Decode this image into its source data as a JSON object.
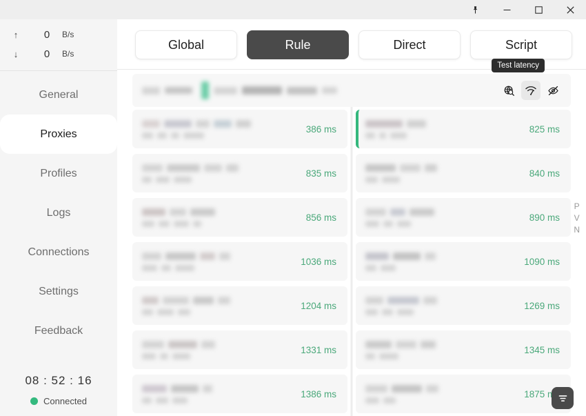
{
  "titlebar": {
    "buttons": [
      {
        "name": "pin-icon",
        "label": "Pin"
      },
      {
        "name": "minimize-icon",
        "label": "Minimize"
      },
      {
        "name": "maximize-icon",
        "label": "Maximize"
      },
      {
        "name": "close-icon",
        "label": "Close"
      }
    ]
  },
  "sidebar": {
    "traffic": {
      "upload": {
        "arrow": "↑",
        "value": "0",
        "unit": "B/s"
      },
      "download": {
        "arrow": "↓",
        "value": "0",
        "unit": "B/s"
      }
    },
    "items": [
      {
        "label": "General",
        "active": false
      },
      {
        "label": "Proxies",
        "active": true
      },
      {
        "label": "Profiles",
        "active": false
      },
      {
        "label": "Logs",
        "active": false
      },
      {
        "label": "Connections",
        "active": false
      },
      {
        "label": "Settings",
        "active": false
      },
      {
        "label": "Feedback",
        "active": false
      }
    ],
    "status": {
      "clock": "08 : 52 : 16",
      "connection": "Connected",
      "connection_color": "#34b97e"
    }
  },
  "main": {
    "mode_tabs": [
      {
        "label": "Global",
        "active": false
      },
      {
        "label": "Rule",
        "active": true
      },
      {
        "label": "Direct",
        "active": false
      },
      {
        "label": "Script",
        "active": false
      }
    ],
    "group_header": {
      "tooltip": "Test latency",
      "icons": [
        {
          "name": "check-availability-icon",
          "selected": false
        },
        {
          "name": "test-latency-icon",
          "selected": true
        },
        {
          "name": "hide-unavailable-icon",
          "selected": false
        }
      ]
    },
    "side_label": [
      "P",
      "V",
      "N"
    ],
    "filter_button": {
      "name": "filter-icon"
    },
    "proxies": {
      "left_column": [
        {
          "latency": "386 ms",
          "selected": false
        },
        {
          "latency": "835 ms",
          "selected": false
        },
        {
          "latency": "856 ms",
          "selected": false
        },
        {
          "latency": "1036 ms",
          "selected": false
        },
        {
          "latency": "1204 ms",
          "selected": false
        },
        {
          "latency": "1331 ms",
          "selected": false
        },
        {
          "latency": "1386 ms",
          "selected": false
        }
      ],
      "right_column": [
        {
          "latency": "825 ms",
          "selected": true
        },
        {
          "latency": "840 ms",
          "selected": false
        },
        {
          "latency": "890 ms",
          "selected": false
        },
        {
          "latency": "1090 ms",
          "selected": false
        },
        {
          "latency": "1269 ms",
          "selected": false
        },
        {
          "latency": "1345 ms",
          "selected": false
        },
        {
          "latency": "1875 ms",
          "selected": false
        }
      ]
    }
  },
  "colors": {
    "accent_green": "#35b87d",
    "latency_green": "#4aa87a",
    "active_tab_bg": "#4a4a4a",
    "sidebar_bg": "#f5f5f5",
    "row_bg": "#f6f6f6"
  }
}
